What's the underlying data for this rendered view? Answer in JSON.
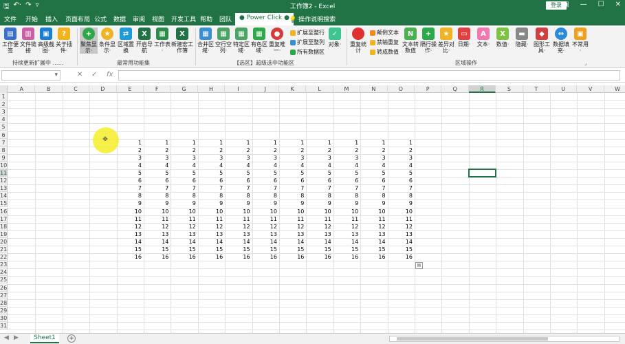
{
  "titlebar": {
    "title": "工作簿2 - Excel",
    "login": "登录",
    "qat": [
      "save-icon",
      "undo-icon",
      "redo-icon",
      "customize-icon"
    ]
  },
  "tabs": [
    "文件",
    "开始",
    "插入",
    "页面布局",
    "公式",
    "数据",
    "审阅",
    "视图",
    "开发工具",
    "帮助",
    "团队",
    "● Power Click ●"
  ],
  "help_search": "操作说明搜索",
  "ribbon": {
    "group1": {
      "label": "持续更新扩展中 …… ",
      "buttons": [
        "工作便签",
        "文件链接",
        "高级截图·",
        "关于插件·"
      ]
    },
    "group2": {
      "label": "最常用功能集",
      "buttons": [
        "聚焦显示·",
        "条件显示·",
        "区域置换",
        "开启导航",
        "工作表·",
        "新建宏工作簿"
      ]
    },
    "group3": {
      "label": "【选区】超级选中功能区",
      "buttons": [
        "合并区域·",
        "空行空列·",
        "特定区域·",
        "有色区域·",
        "重复唯一·"
      ],
      "small": [
        "扩展至整行",
        "扩展至整列",
        "所有数据区"
      ],
      "object": "对象·"
    },
    "group4": {
      "label": "区域操作",
      "buttons": [
        "重复统计",
        "文本转数值",
        "隔行操作·",
        "差异对比·",
        "日期·",
        "文本·",
        "数值·",
        "隐藏·",
        "图形工具·",
        "数据填充·",
        "不常用·"
      ],
      "small": [
        "颠倒文本",
        "禁输重复",
        "转成数值"
      ]
    }
  },
  "formula": {
    "namebox": "",
    "cancel": "✕",
    "enter": "✓",
    "fx": "fx",
    "value": ""
  },
  "columns": [
    "A",
    "B",
    "C",
    "D",
    "E",
    "F",
    "G",
    "H",
    "I",
    "J",
    "K",
    "L",
    "M",
    "N",
    "O",
    "P",
    "Q",
    "R",
    "S",
    "T",
    "U",
    "V",
    "W"
  ],
  "active_column": "R",
  "active_row": "11",
  "rows": [
    "1",
    "2",
    "3",
    "4",
    "5",
    "6",
    "7",
    "8",
    "9",
    "10",
    "11",
    "12",
    "13",
    "14",
    "15",
    "16",
    "17",
    "18",
    "19",
    "20",
    "21",
    "22",
    "23",
    "24",
    "25",
    "26",
    "27",
    "28",
    "29",
    "30",
    "31"
  ],
  "data_columns": [
    "E",
    "F",
    "G",
    "H",
    "I",
    "J",
    "K",
    "L",
    "M",
    "N",
    "O"
  ],
  "data_first_row": 7,
  "data_values": [
    1,
    2,
    3,
    4,
    5,
    6,
    7,
    8,
    9,
    10,
    11,
    12,
    13,
    14,
    15,
    16
  ],
  "sheet": {
    "name": "Sheet1",
    "add": "+"
  }
}
